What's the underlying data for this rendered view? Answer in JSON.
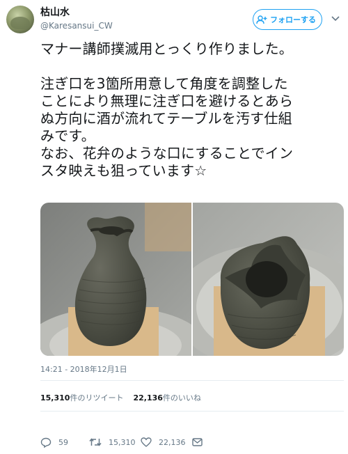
{
  "user": {
    "display_name": "枯山水",
    "handle": "@Karesansui_CW",
    "follow_label": "フォローする"
  },
  "tweet": {
    "lines": [
      "マナー講師撲滅用とっくり作りました。",
      "",
      "注ぎ口を3箇所用意して角度を調整した",
      "ことにより無理に注ぎ口を避けるとあら",
      "ぬ方向に酒が流れてテーブルを汚す仕組",
      "みです。",
      "なお、花弁のような口にすることでイン",
      "スタ映えも狙っています☆"
    ],
    "timestamp": "14:21 - 2018年12月1日"
  },
  "stats": {
    "retweets_count": "15,310",
    "retweets_label": "件のリツイート",
    "likes_count": "22,136",
    "likes_label": "件のいいね"
  },
  "actions": {
    "reply_count": "59",
    "retweet_count": "15,310",
    "like_count": "22,136"
  },
  "icons": {
    "follow_icon": "add-user-icon",
    "caret_icon": "chevron-down-icon",
    "reply_icon": "reply-icon",
    "retweet_icon": "retweet-icon",
    "like_icon": "heart-icon",
    "dm_icon": "envelope-icon"
  },
  "colors": {
    "accent": "#1da1f2",
    "secondary_text": "#657786",
    "divider": "#e6ecf0"
  }
}
